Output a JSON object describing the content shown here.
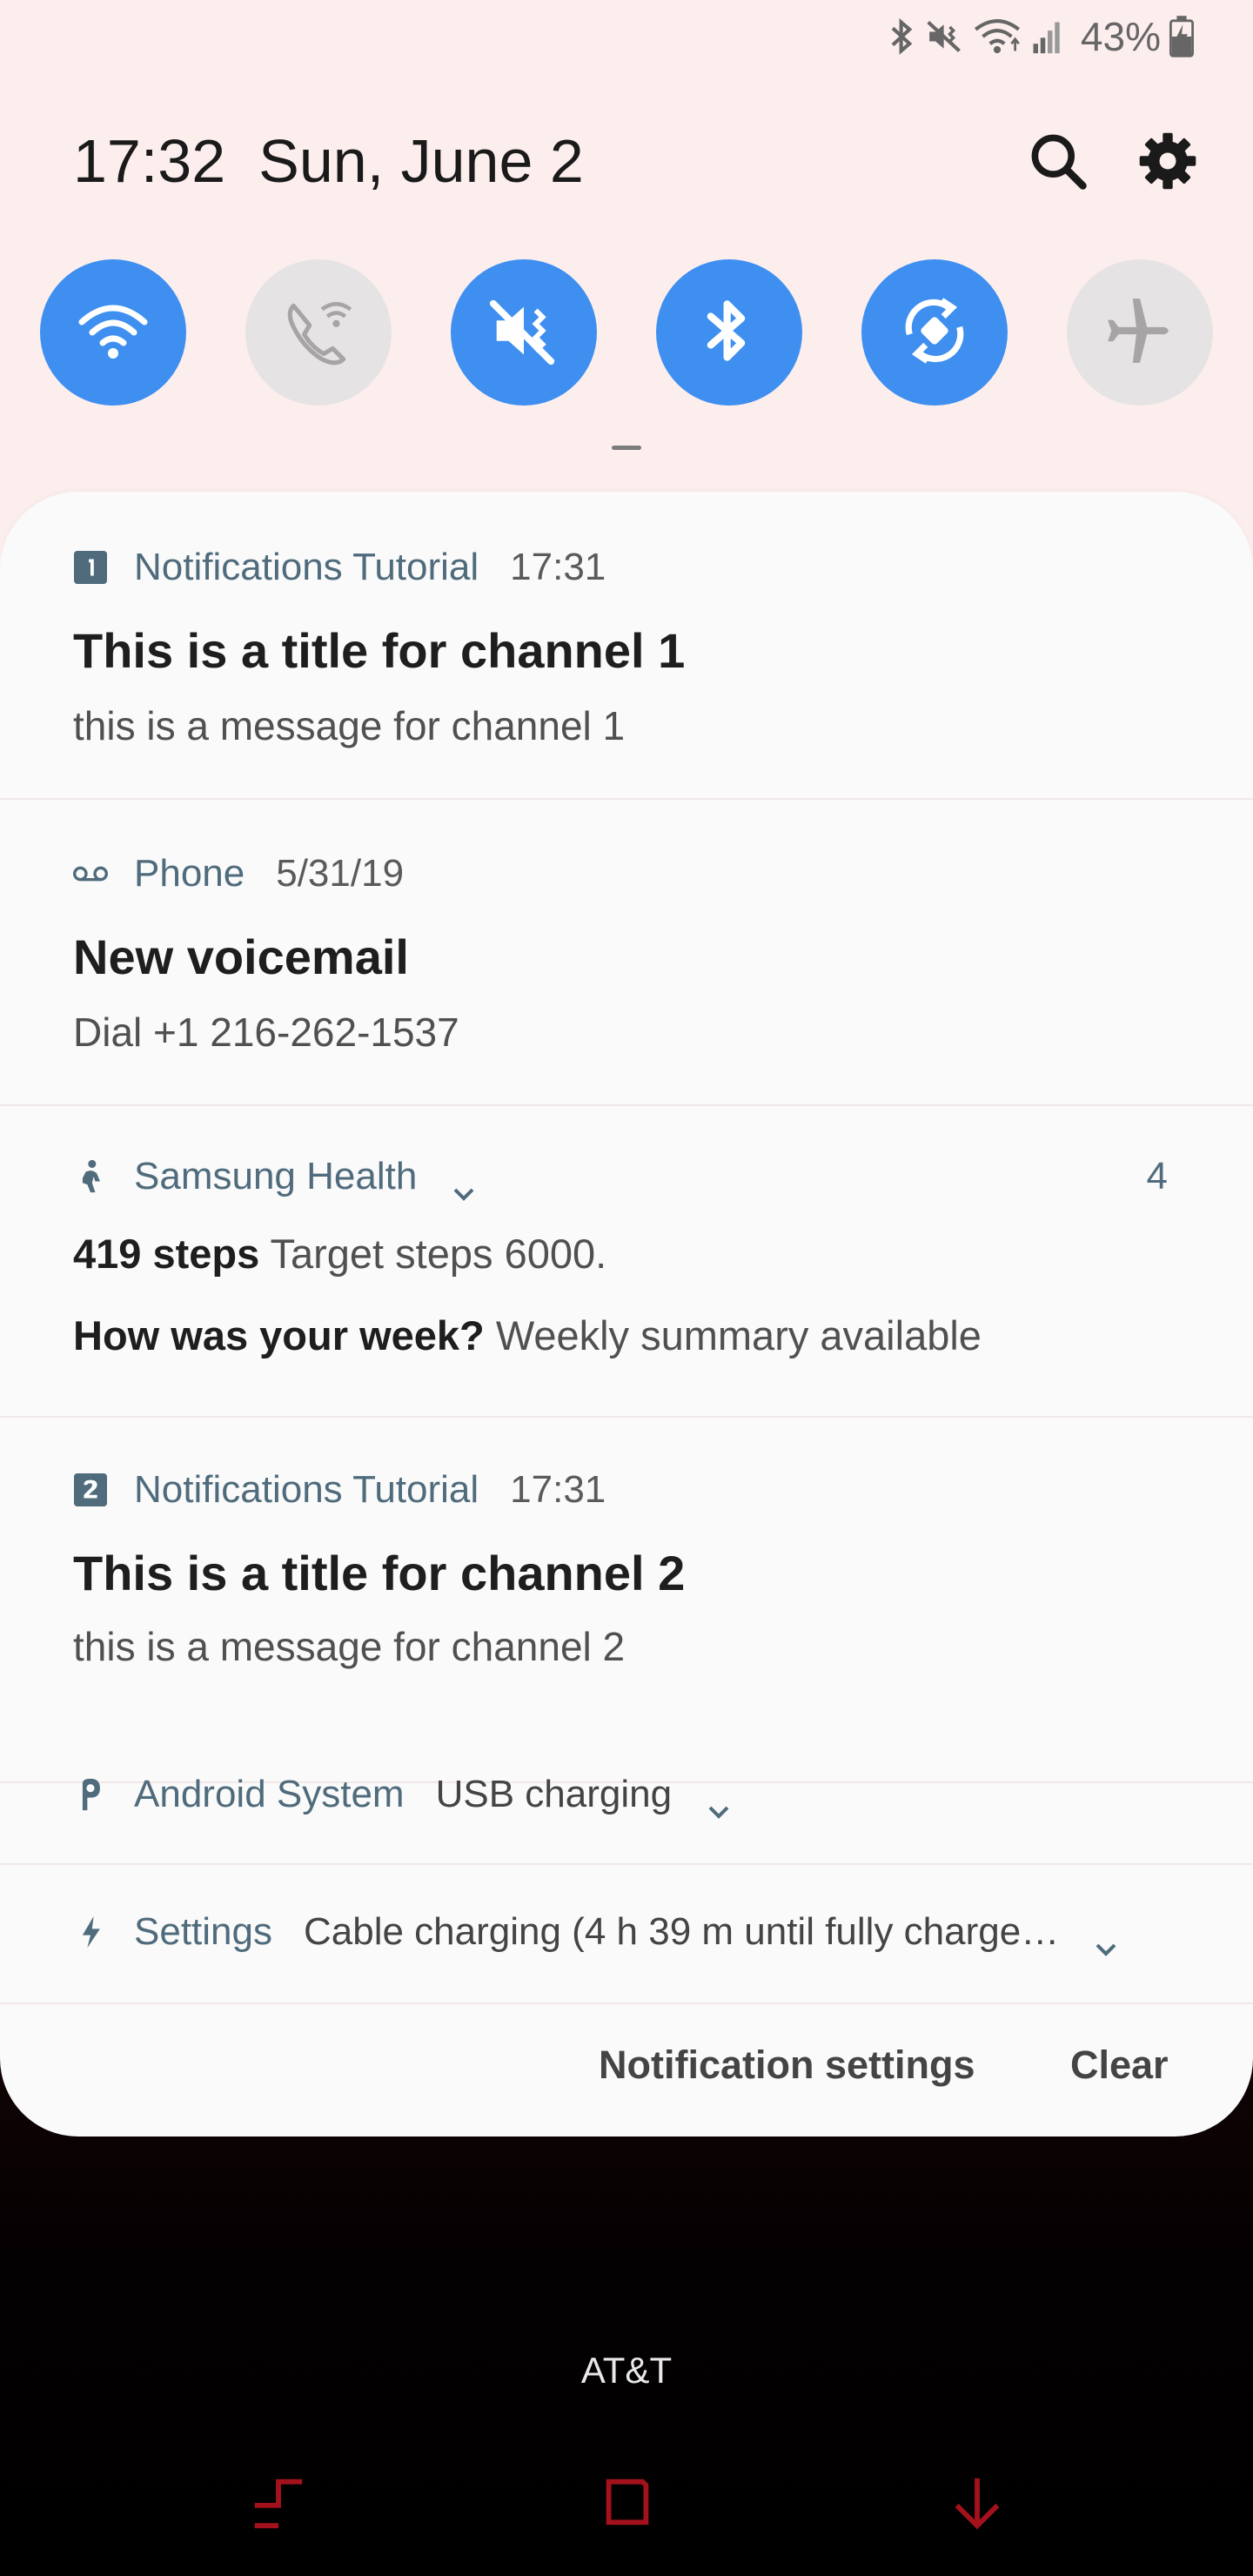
{
  "status_bar": {
    "battery": "43%",
    "icons": [
      "bluetooth-icon",
      "vibrate-mute-icon",
      "wifi-icon",
      "signal-icon",
      "battery-charging-icon"
    ]
  },
  "header": {
    "time": "17:32",
    "date": "Sun, June 2",
    "icons": [
      "search-icon",
      "gear-icon"
    ]
  },
  "quick_toggles": [
    {
      "name": "Wi-Fi",
      "icon": "wifi-icon",
      "on": true
    },
    {
      "name": "Wi-Fi Calling",
      "icon": "wifi-calling-icon",
      "on": false
    },
    {
      "name": "Mute",
      "icon": "mute-icon",
      "on": true
    },
    {
      "name": "Bluetooth",
      "icon": "bluetooth-icon",
      "on": true
    },
    {
      "name": "Auto rotate",
      "icon": "auto-rotate-icon",
      "on": true
    },
    {
      "name": "Airplane mode",
      "icon": "airplane-icon",
      "on": false
    }
  ],
  "notifications": [
    {
      "app": "Notifications Tutorial",
      "time": "17:31",
      "icon": "channel-1-icon",
      "title": "This is a title for channel 1",
      "message": "this is a message for channel 1"
    },
    {
      "app": "Phone",
      "time": "5/31/19",
      "icon": "voicemail-icon",
      "title": "New voicemail",
      "message": "Dial +1 216-262-1537"
    },
    {
      "app": "Samsung Health",
      "icon": "samsung-health-icon",
      "count": "4",
      "line1_bold": "419 steps",
      "line1_text": "Target steps 6000.",
      "line2_bold": "How was your week?",
      "line2_text": "Weekly summary available"
    },
    {
      "app": "Notifications Tutorial",
      "time": "17:31",
      "icon": "channel-2-icon",
      "title": "This is a title for channel 2",
      "message": "this is a message for channel 2"
    },
    {
      "app": "Android System",
      "icon": "android-system-icon",
      "summary": "USB charging"
    },
    {
      "app": "Settings",
      "icon": "charging-bolt-icon",
      "summary": "Cable charging (4 h 39 m until fully charge…"
    }
  ],
  "footer": {
    "notification_settings": "Notification settings",
    "clear": "Clear"
  },
  "carrier": "AT&T",
  "colors": {
    "toggle_on": "#3e8ff0",
    "toggle_off": "#e6e3e4",
    "shade_bg": "#fdeeee",
    "panel_bg": "#fafafa",
    "app_name": "#4f6b7c"
  },
  "nav_bar": [
    "recents-icon",
    "home-icon",
    "back-icon"
  ]
}
